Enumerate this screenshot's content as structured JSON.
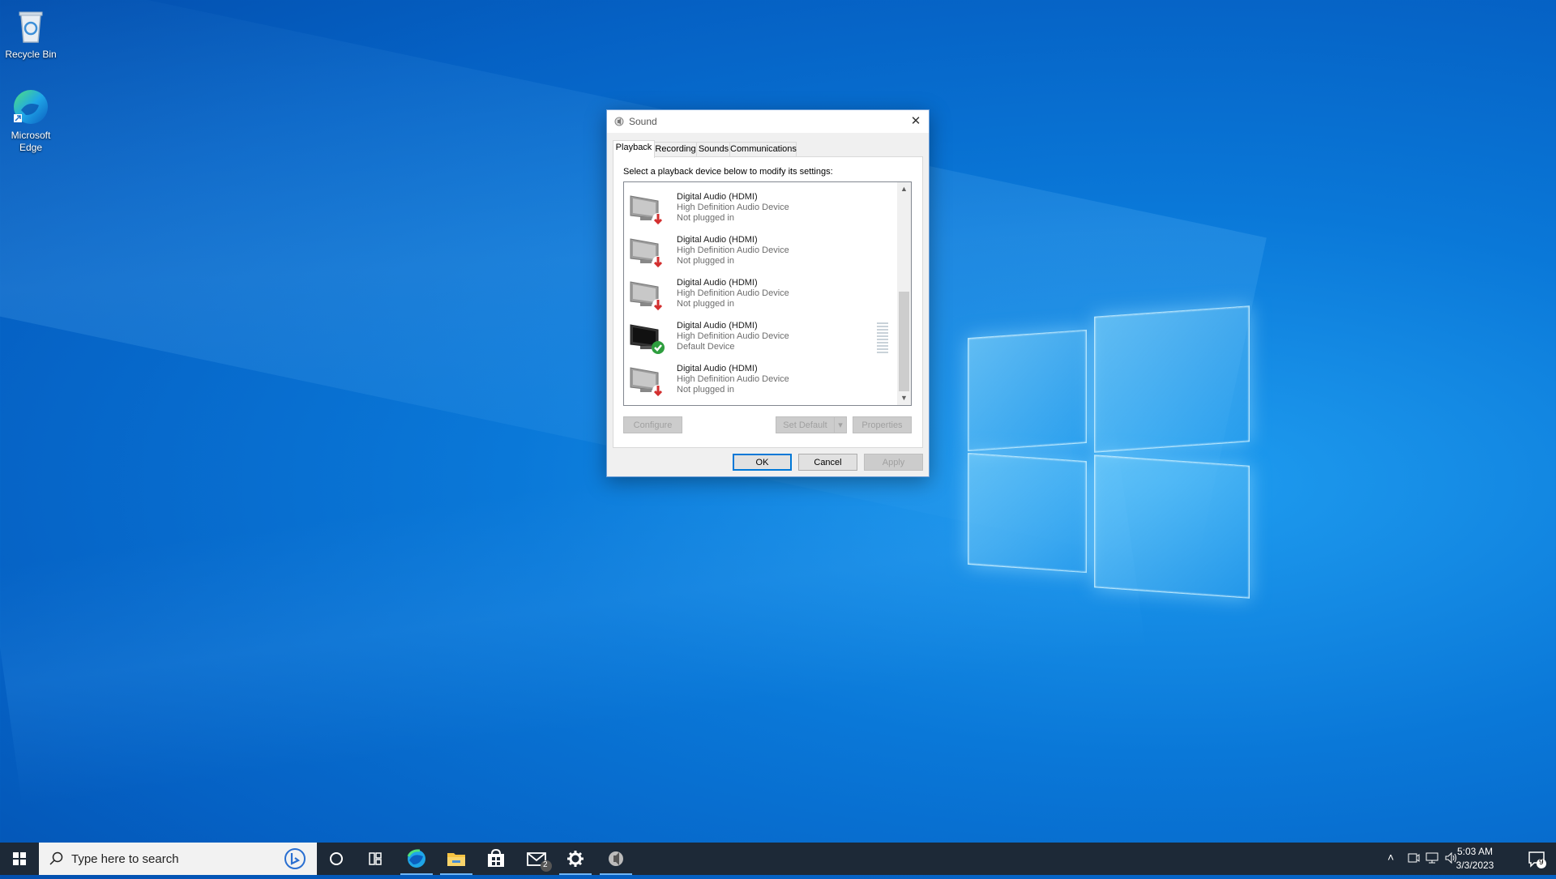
{
  "desktop": {
    "icons": [
      {
        "label": "Recycle Bin",
        "icon": "recycle-bin-icon"
      },
      {
        "label": "Microsoft Edge",
        "icon": "edge-icon"
      }
    ]
  },
  "dialog": {
    "title": "Sound",
    "tabs": [
      "Playback",
      "Recording",
      "Sounds",
      "Communications"
    ],
    "active_tab": "Playback",
    "instruction": "Select a playback device below to modify its settings:",
    "devices": [
      {
        "name": "Digital Audio (HDMI)",
        "driver": "High Definition Audio Device",
        "status": "Not plugged in",
        "state": "unplugged"
      },
      {
        "name": "Digital Audio (HDMI)",
        "driver": "High Definition Audio Device",
        "status": "Not plugged in",
        "state": "unplugged"
      },
      {
        "name": "Digital Audio (HDMI)",
        "driver": "High Definition Audio Device",
        "status": "Not plugged in",
        "state": "unplugged"
      },
      {
        "name": "Digital Audio (HDMI)",
        "driver": "High Definition Audio Device",
        "status": "Default Device",
        "state": "default"
      },
      {
        "name": "Digital Audio (HDMI)",
        "driver": "High Definition Audio Device",
        "status": "Not plugged in",
        "state": "unplugged"
      }
    ],
    "buttons": {
      "configure": "Configure",
      "set_default": "Set Default",
      "properties": "Properties",
      "ok": "OK",
      "cancel": "Cancel",
      "apply": "Apply"
    }
  },
  "taskbar": {
    "search_placeholder": "Type here to search",
    "apps": [
      "edge-icon",
      "file-explorer-icon",
      "store-icon",
      "mail-icon",
      "settings-icon",
      "sound-icon"
    ],
    "mail_badge": "2",
    "clock_time": "5:03 AM",
    "clock_date": "3/3/2023",
    "notification_count": "9"
  },
  "colors": {
    "accent": "#0078d7",
    "taskbar": "#1d2937",
    "unplugged_badge": "#d32f2f",
    "default_badge": "#2e9e3e"
  }
}
